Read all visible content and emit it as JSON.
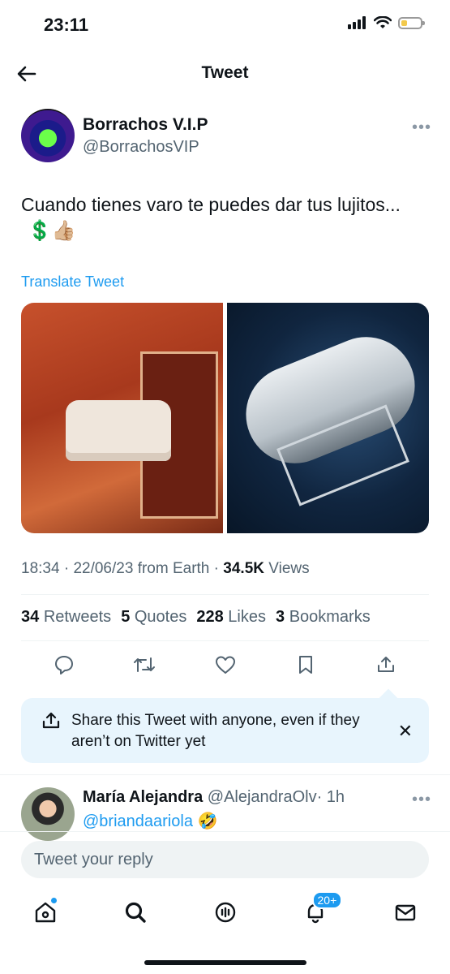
{
  "status_bar": {
    "time": "23:11"
  },
  "header": {
    "title": "Tweet"
  },
  "tweet": {
    "author_name": "Borrachos V.I.P",
    "author_handle": "@BorrachosVIP",
    "text": "Cuando tienes varo te puedes dar tus lujitos...",
    "emoji": "💲👍🏼",
    "translate_label": "Translate Tweet",
    "time": "18:34",
    "date": "22/06/23",
    "source": "from Earth",
    "views_count": "34.5K",
    "views_label": "Views",
    "retweets_count": "34",
    "retweets_label": "Retweets",
    "quotes_count": "5",
    "quotes_label": "Quotes",
    "likes_count": "228",
    "likes_label": "Likes",
    "bookmarks_count": "3",
    "bookmarks_label": "Bookmarks"
  },
  "share_banner": {
    "text": "Share this Tweet with anyone, even if they aren’t on Twitter yet"
  },
  "reply": {
    "name": "María Alejandra",
    "handle": "@AlejandraOlv",
    "age": "· 1h",
    "mention": "@briandaariola",
    "emoji": "🤣"
  },
  "composer": {
    "placeholder": "Tweet your reply"
  },
  "tabbar": {
    "notifications_badge": "20+"
  },
  "colors": {
    "accent": "#1d9bf0",
    "secondary_text": "#536471",
    "banner_bg": "#e8f5fd"
  }
}
